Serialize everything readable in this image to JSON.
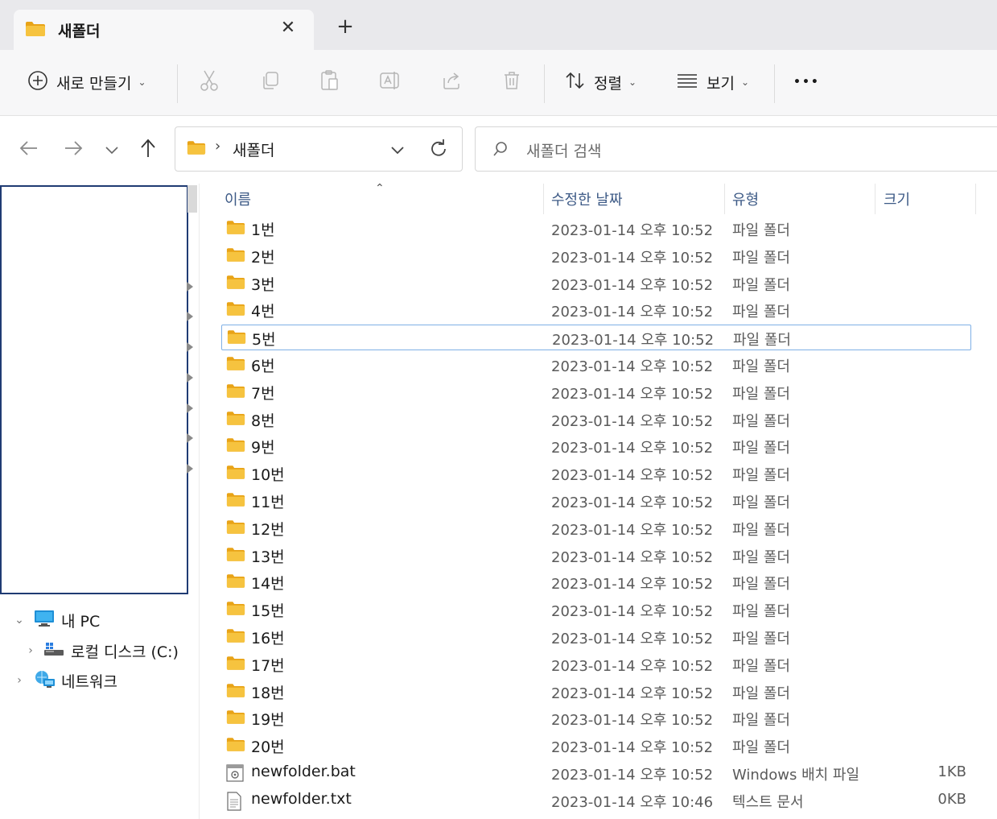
{
  "tab": {
    "title": "새폴더",
    "close_glyph": "✕",
    "new_tab_glyph": "+"
  },
  "toolbar": {
    "new_label": "새로 만들기",
    "sort_label": "정렬",
    "view_label": "보기",
    "more_glyph": "•••",
    "icons": [
      "cut-icon",
      "copy-icon",
      "paste-icon",
      "rename-icon",
      "share-icon",
      "delete-icon"
    ]
  },
  "address": {
    "folder": "새폴더",
    "separator": "›",
    "search_placeholder": "새폴더 검색"
  },
  "nav": {
    "items": [
      {
        "label": "내 PC",
        "expander": "⌄",
        "icon": "pc-icon"
      },
      {
        "label": "로컬 디스크 (C:)",
        "expander": "›",
        "icon": "drive-icon"
      },
      {
        "label": "네트워크",
        "expander": "›",
        "icon": "network-icon"
      }
    ]
  },
  "columns": {
    "name": "이름",
    "modified": "수정한 날짜",
    "type": "유형",
    "size": "크기",
    "sort_glyph": "⌃"
  },
  "files": [
    {
      "name": "1번",
      "date": "2023-01-14 오후 10:52",
      "type": "파일 폴더",
      "size": "",
      "kind": "folder"
    },
    {
      "name": "2번",
      "date": "2023-01-14 오후 10:52",
      "type": "파일 폴더",
      "size": "",
      "kind": "folder"
    },
    {
      "name": "3번",
      "date": "2023-01-14 오후 10:52",
      "type": "파일 폴더",
      "size": "",
      "kind": "folder"
    },
    {
      "name": "4번",
      "date": "2023-01-14 오후 10:52",
      "type": "파일 폴더",
      "size": "",
      "kind": "folder"
    },
    {
      "name": "5번",
      "date": "2023-01-14 오후 10:52",
      "type": "파일 폴더",
      "size": "",
      "kind": "folder",
      "selected": true
    },
    {
      "name": "6번",
      "date": "2023-01-14 오후 10:52",
      "type": "파일 폴더",
      "size": "",
      "kind": "folder"
    },
    {
      "name": "7번",
      "date": "2023-01-14 오후 10:52",
      "type": "파일 폴더",
      "size": "",
      "kind": "folder"
    },
    {
      "name": "8번",
      "date": "2023-01-14 오후 10:52",
      "type": "파일 폴더",
      "size": "",
      "kind": "folder"
    },
    {
      "name": "9번",
      "date": "2023-01-14 오후 10:52",
      "type": "파일 폴더",
      "size": "",
      "kind": "folder"
    },
    {
      "name": "10번",
      "date": "2023-01-14 오후 10:52",
      "type": "파일 폴더",
      "size": "",
      "kind": "folder"
    },
    {
      "name": "11번",
      "date": "2023-01-14 오후 10:52",
      "type": "파일 폴더",
      "size": "",
      "kind": "folder"
    },
    {
      "name": "12번",
      "date": "2023-01-14 오후 10:52",
      "type": "파일 폴더",
      "size": "",
      "kind": "folder"
    },
    {
      "name": "13번",
      "date": "2023-01-14 오후 10:52",
      "type": "파일 폴더",
      "size": "",
      "kind": "folder"
    },
    {
      "name": "14번",
      "date": "2023-01-14 오후 10:52",
      "type": "파일 폴더",
      "size": "",
      "kind": "folder"
    },
    {
      "name": "15번",
      "date": "2023-01-14 오후 10:52",
      "type": "파일 폴더",
      "size": "",
      "kind": "folder"
    },
    {
      "name": "16번",
      "date": "2023-01-14 오후 10:52",
      "type": "파일 폴더",
      "size": "",
      "kind": "folder"
    },
    {
      "name": "17번",
      "date": "2023-01-14 오후 10:52",
      "type": "파일 폴더",
      "size": "",
      "kind": "folder"
    },
    {
      "name": "18번",
      "date": "2023-01-14 오후 10:52",
      "type": "파일 폴더",
      "size": "",
      "kind": "folder"
    },
    {
      "name": "19번",
      "date": "2023-01-14 오후 10:52",
      "type": "파일 폴더",
      "size": "",
      "kind": "folder"
    },
    {
      "name": "20번",
      "date": "2023-01-14 오후 10:52",
      "type": "파일 폴더",
      "size": "",
      "kind": "folder"
    },
    {
      "name": "newfolder.bat",
      "date": "2023-01-14 오후 10:52",
      "type": "Windows 배치 파일",
      "size": "1KB",
      "kind": "bat"
    },
    {
      "name": "newfolder.txt",
      "date": "2023-01-14 오후 10:46",
      "type": "텍스트 문서",
      "size": "0KB",
      "kind": "txt"
    }
  ],
  "colors": {
    "folder": "#f6c33f",
    "folder_tab": "#e8a317",
    "selection_border": "#7fb0e6",
    "header_text": "#3d5a86",
    "nav_box_border": "#1f3b73"
  }
}
